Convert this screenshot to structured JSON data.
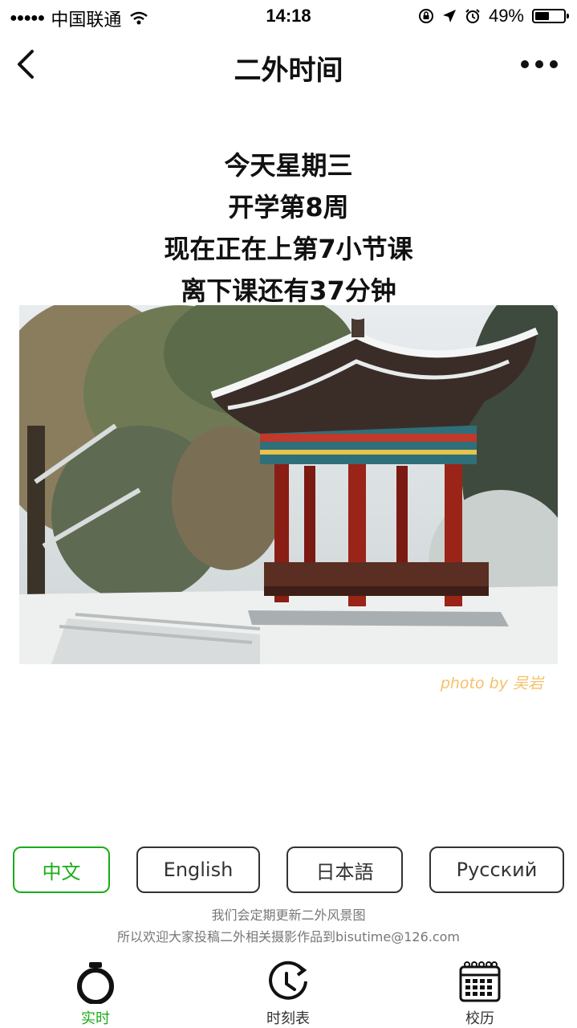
{
  "status_bar": {
    "carrier": "中国联通",
    "time": "14:18",
    "battery": "49%",
    "battery_level": 0.49
  },
  "nav": {
    "title": "二外时间"
  },
  "info": {
    "line1": "今天星期三",
    "line2": "开学第8周",
    "line3": "现在正在上第7小节课",
    "line4": "离下课还有37分钟"
  },
  "photo": {
    "credit": "photo by 吴岩"
  },
  "languages": [
    {
      "label": "中文",
      "active": true
    },
    {
      "label": "English",
      "active": false
    },
    {
      "label": "日本語",
      "active": false
    },
    {
      "label": "Русский",
      "active": false
    }
  ],
  "notice": {
    "line1": "我们会定期更新二外风景图",
    "line2": "所以欢迎大家投稿二外相关摄影作品到bisutime@126.com"
  },
  "tabs": [
    {
      "label": "实时",
      "icon": "stopwatch-icon",
      "active": true
    },
    {
      "label": "时刻表",
      "icon": "clock-icon",
      "active": false
    },
    {
      "label": "校历",
      "icon": "calendar-icon",
      "active": false
    }
  ],
  "colors": {
    "accent": "#1aad19",
    "credit": "#f5c16a"
  }
}
